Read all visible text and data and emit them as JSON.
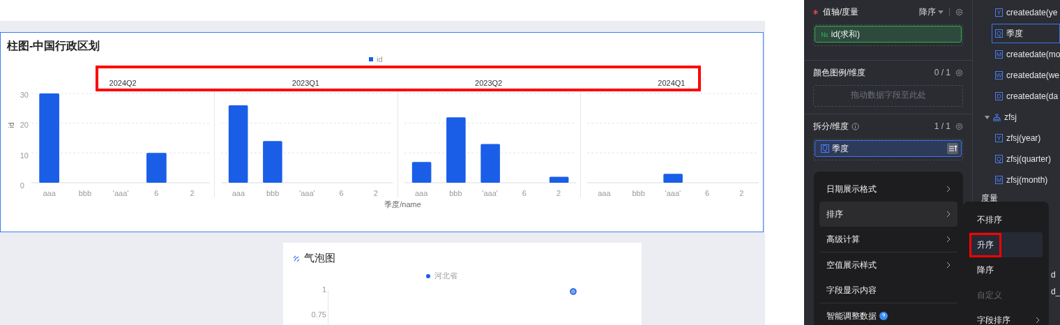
{
  "bar_card": {
    "title": "柱图-中国行政区划",
    "highlight_frame": true,
    "chart_data": {
      "type": "bar",
      "ylabel": "id",
      "xlabel": "季度/name",
      "categories": [
        "aaa",
        "bbb",
        "'aaa'",
        "6",
        "2",
        "aaa",
        "bbb",
        "'aaa'",
        "6",
        "2",
        "aaa",
        "bbb",
        "'aaa'",
        "6",
        "2",
        "aaa",
        "bbb",
        "'aaa'",
        "6",
        "2"
      ],
      "ylim": [
        0,
        30
      ],
      "yticks": [
        0,
        10,
        20,
        30
      ],
      "grid": true,
      "series": [
        {
          "name": "id",
          "color": "#1a5ee8",
          "values": [
            30,
            null,
            null,
            10,
            null,
            26,
            14,
            null,
            null,
            null,
            7,
            22,
            13,
            null,
            2,
            null,
            null,
            3,
            null,
            null
          ]
        }
      ],
      "annotations": [
        {
          "text": "2024Q2"
        },
        {
          "text": "2023Q1"
        },
        {
          "text": "2023Q2"
        },
        {
          "text": "2024Q1"
        }
      ]
    }
  },
  "bubble_card": {
    "title": "气泡图",
    "legend": {
      "label": "河北省",
      "color": "#1a5ee8"
    },
    "yticks": [
      "1",
      "0.75"
    ]
  },
  "config": {
    "sections": [
      {
        "title": "值轴/度量",
        "required": true,
        "info_icon": false,
        "sort": "降序",
        "fields": [
          {
            "kind": "measure",
            "badge": "№",
            "label": "id(求和)"
          }
        ]
      },
      {
        "title": "颜色图例/维度",
        "required": false,
        "info_icon": false,
        "count": "0 / 1",
        "placeholder": "拖动数据字段至此处"
      },
      {
        "title": "拆分/维度",
        "required": false,
        "info_icon": true,
        "count": "1 / 1",
        "fields": [
          {
            "kind": "dimension",
            "badge": "Q",
            "label": "季度"
          }
        ]
      }
    ]
  },
  "context_menu": {
    "items": [
      {
        "label": "日期展示格式",
        "submenu": true,
        "selected": false,
        "help_icon": false,
        "divider_after": false
      },
      {
        "label": "排序",
        "submenu": true,
        "selected": true,
        "help_icon": false,
        "divider_after": false
      },
      {
        "label": "高级计算",
        "submenu": true,
        "selected": false,
        "help_icon": false,
        "divider_after": true
      },
      {
        "label": "空值展示样式",
        "submenu": true,
        "selected": false,
        "help_icon": false,
        "divider_after": false
      },
      {
        "label": "字段显示内容",
        "submenu": false,
        "selected": false,
        "help_icon": false,
        "divider_after": true
      },
      {
        "label": "智能调整数据",
        "submenu": false,
        "selected": false,
        "help_icon": true,
        "divider_after": false
      }
    ]
  },
  "sort_submenu": {
    "items": [
      {
        "label": "不排序",
        "selected": false,
        "disabled": false,
        "framed": false,
        "submenu": false
      },
      {
        "label": "升序",
        "selected": true,
        "disabled": false,
        "framed": true,
        "submenu": false
      },
      {
        "label": "降序",
        "selected": false,
        "disabled": false,
        "framed": false,
        "submenu": false
      },
      {
        "label": "自定义",
        "selected": false,
        "disabled": true,
        "framed": false,
        "submenu": false
      },
      {
        "label": "字段排序",
        "selected": false,
        "disabled": false,
        "framed": false,
        "submenu": true
      }
    ]
  },
  "field_list": {
    "items": [
      {
        "badge": "Y",
        "label": "createdate(ye",
        "selected": false
      },
      {
        "badge": "Q",
        "label": "季度",
        "selected": true
      },
      {
        "badge": "M",
        "label": "createdate(mo",
        "selected": false
      },
      {
        "badge": "W",
        "label": "createdate(we",
        "selected": false
      },
      {
        "badge": "D",
        "label": "createdate(da",
        "selected": false
      },
      {
        "label": "zfsj",
        "expanded": true,
        "children": [
          {
            "badge": "Y",
            "label": "zfsj(year)",
            "selected": false
          },
          {
            "badge": "Q",
            "label": "zfsj(quarter)",
            "selected": false
          },
          {
            "badge": "M",
            "label": "zfsj(month)",
            "selected": false
          }
        ]
      }
    ],
    "measure_heading": "度量",
    "fragments": [
      "d",
      "d_"
    ]
  }
}
